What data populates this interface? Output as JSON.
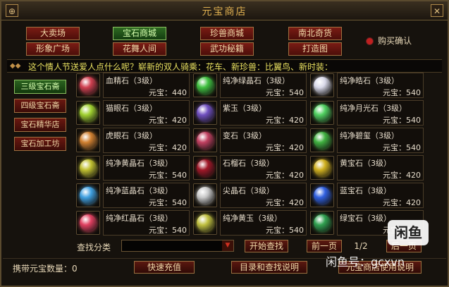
{
  "window": {
    "title": "元宝商店"
  },
  "titlebar": {
    "help_icon": "⊕",
    "close_icon": "✕"
  },
  "nav": {
    "items": [
      {
        "label": "大卖场"
      },
      {
        "label": "宝石商城"
      },
      {
        "label": "珍兽商城"
      },
      {
        "label": "南北奇货"
      },
      {
        "label": "形象广场"
      },
      {
        "label": "花舞人间"
      },
      {
        "label": "武功秘籍"
      },
      {
        "label": "打造图"
      }
    ],
    "active": "宝石商城"
  },
  "buy_confirm": {
    "label": "购买确认"
  },
  "marquee": {
    "text": "这个情人节送爱人点什么呢？崭新的双人骑乘：花车、新珍兽：比翼鸟、新时装："
  },
  "sidebar": {
    "items": [
      {
        "label": "三级宝石斋"
      },
      {
        "label": "四级宝石斋"
      },
      {
        "label": "宝石精华店"
      },
      {
        "label": "宝石加工坊"
      }
    ],
    "active": "三级宝石斋"
  },
  "items": [
    {
      "name": "血精石（3级）",
      "price": "元宝：440",
      "icon": "blood-gem-icon",
      "color": "#d04050"
    },
    {
      "name": "纯净绿晶石（3级）",
      "price": "元宝：540",
      "icon": "green-crystal-icon",
      "color": "#40c040"
    },
    {
      "name": "纯净皓石（3级）",
      "price": "元宝：540",
      "icon": "white-gem-icon",
      "color": "#d8d8e8"
    },
    {
      "name": "猫眼石（3级）",
      "price": "元宝：420",
      "icon": "cat-eye-gem-icon",
      "color": "#a0d030"
    },
    {
      "name": "紫玉（3级）",
      "price": "元宝：420",
      "icon": "purple-jade-icon",
      "color": "#7050c0"
    },
    {
      "name": "纯净月光石（3级）",
      "price": "元宝：540",
      "icon": "moonstone-icon",
      "color": "#50d060"
    },
    {
      "name": "虎眼石（3级）",
      "price": "元宝：420",
      "icon": "tiger-eye-icon",
      "color": "#d08030"
    },
    {
      "name": "变石（3级）",
      "price": "元宝：420",
      "icon": "change-gem-icon",
      "color": "#c04060"
    },
    {
      "name": "纯净碧玺（3级）",
      "price": "元宝：540",
      "icon": "tourmaline-icon",
      "color": "#40b040"
    },
    {
      "name": "纯净黄晶石（3级）",
      "price": "元宝：540",
      "icon": "yellow-crystal-icon",
      "color": "#c0c030"
    },
    {
      "name": "石榴石（3级）",
      "price": "元宝：420",
      "icon": "garnet-icon",
      "color": "#a01828"
    },
    {
      "name": "黄宝石（3级）",
      "price": "元宝：420",
      "icon": "topaz-icon",
      "color": "#d0b020"
    },
    {
      "name": "纯净蓝晶石（3级）",
      "price": "元宝：540",
      "icon": "blue-crystal-icon",
      "color": "#40a0e0"
    },
    {
      "name": "尖晶石（3级）",
      "price": "元宝：420",
      "icon": "spinel-icon",
      "color": "#c8c8c8"
    },
    {
      "name": "蓝宝石（3级）",
      "price": "元宝：420",
      "icon": "sapphire-icon",
      "color": "#3060e0"
    },
    {
      "name": "纯净红晶石（3级）",
      "price": "元宝：540",
      "icon": "red-crystal-icon",
      "color": "#e04060"
    },
    {
      "name": "纯净黄玉（3级）",
      "price": "元宝：540",
      "icon": "yellow-jade-icon",
      "color": "#c0c040"
    },
    {
      "name": "绿宝石（3级）",
      "price": "元宝：420",
      "icon": "emerald-icon",
      "color": "#30a050"
    }
  ],
  "search": {
    "label": "查找分类",
    "value": "",
    "start_label": "开始查找"
  },
  "pager": {
    "prev_label": "前一页",
    "page": "1/2",
    "next_label": "后一页"
  },
  "bottom": {
    "carry_label": "携带元宝数量：0",
    "recharge_label": "快速充值",
    "catalog_label": "目录和查找说明",
    "help_label": "元宝商店使用说明"
  },
  "watermark": {
    "logo": "闲鱼",
    "text": "闲鱼号：gcxvn"
  },
  "colors": {
    "nav_red": "#6a1810",
    "nav_green": "#2c6420",
    "gold": "#e0b050"
  }
}
